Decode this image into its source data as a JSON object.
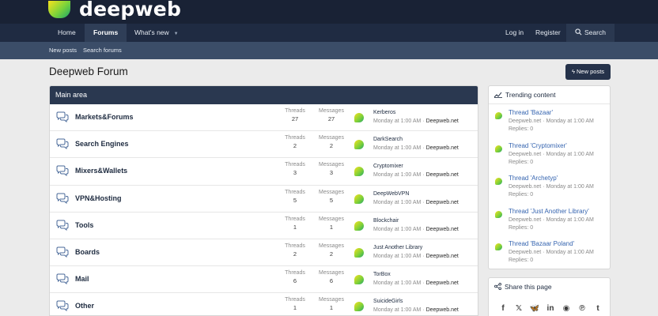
{
  "header": {
    "logo_text": "deepweb"
  },
  "nav": {
    "tabs": [
      {
        "label": "Home"
      },
      {
        "label": "Forums"
      },
      {
        "label": "What's new"
      }
    ],
    "login": "Log in",
    "register": "Register",
    "search": "Search"
  },
  "subnav": {
    "items": [
      "New posts",
      "Search forums"
    ]
  },
  "page": {
    "title": "Deepweb Forum",
    "new_posts_button": "New posts"
  },
  "forum": {
    "section_title": "Main area",
    "threads_label": "Threads",
    "messages_label": "Messages",
    "rows": [
      {
        "name": "Markets&Forums",
        "threads": "27",
        "messages": "27",
        "latest_title": "Kerberos",
        "latest_time": "Monday at 1:00 AM",
        "latest_user": "Deepweb.net"
      },
      {
        "name": "Search Engines",
        "threads": "2",
        "messages": "2",
        "latest_title": "DarkSearch",
        "latest_time": "Monday at 1:00 AM",
        "latest_user": "Deepweb.net"
      },
      {
        "name": "Mixers&Wallets",
        "threads": "3",
        "messages": "3",
        "latest_title": "Cryptomixer",
        "latest_time": "Monday at 1:00 AM",
        "latest_user": "Deepweb.net"
      },
      {
        "name": "VPN&Hosting",
        "threads": "5",
        "messages": "5",
        "latest_title": "DeepWebVPN",
        "latest_time": "Monday at 1:00 AM",
        "latest_user": "Deepweb.net"
      },
      {
        "name": "Tools",
        "threads": "1",
        "messages": "1",
        "latest_title": "Blockchair",
        "latest_time": "Monday at 1:00 AM",
        "latest_user": "Deepweb.net"
      },
      {
        "name": "Boards",
        "threads": "2",
        "messages": "2",
        "latest_title": "Just Another Library",
        "latest_time": "Monday at 1:00 AM",
        "latest_user": "Deepweb.net"
      },
      {
        "name": "Mail",
        "threads": "6",
        "messages": "6",
        "latest_title": "TorBox",
        "latest_time": "Monday at 1:00 AM",
        "latest_user": "Deepweb.net"
      },
      {
        "name": "Other",
        "threads": "1",
        "messages": "1",
        "latest_title": "SuicideGirls",
        "latest_time": "Monday at 1:00 AM",
        "latest_user": "Deepweb.net"
      }
    ]
  },
  "trending": {
    "title": "Trending content",
    "items": [
      {
        "title": "Thread 'Bazaar'",
        "user": "Deepweb.net",
        "time": "Monday at 1:00 AM",
        "replies": "Replies: 0"
      },
      {
        "title": "Thread 'Cryptomixer'",
        "user": "Deepweb.net",
        "time": "Monday at 1:00 AM",
        "replies": "Replies: 0"
      },
      {
        "title": "Thread 'Archetyp'",
        "user": "Deepweb.net",
        "time": "Monday at 1:00 AM",
        "replies": "Replies: 0"
      },
      {
        "title": "Thread 'Just Another Library'",
        "user": "Deepweb.net",
        "time": "Monday at 1:00 AM",
        "replies": "Replies: 0"
      },
      {
        "title": "Thread 'Bazaar Poland'",
        "user": "Deepweb.net",
        "time": "Monday at 1:00 AM",
        "replies": "Replies: 0"
      }
    ]
  },
  "share": {
    "title": "Share this page",
    "icons": [
      "facebook-icon",
      "x-icon",
      "bluesky-icon",
      "linkedin-icon",
      "reddit-icon",
      "pinterest-icon",
      "tumblr-icon"
    ]
  }
}
